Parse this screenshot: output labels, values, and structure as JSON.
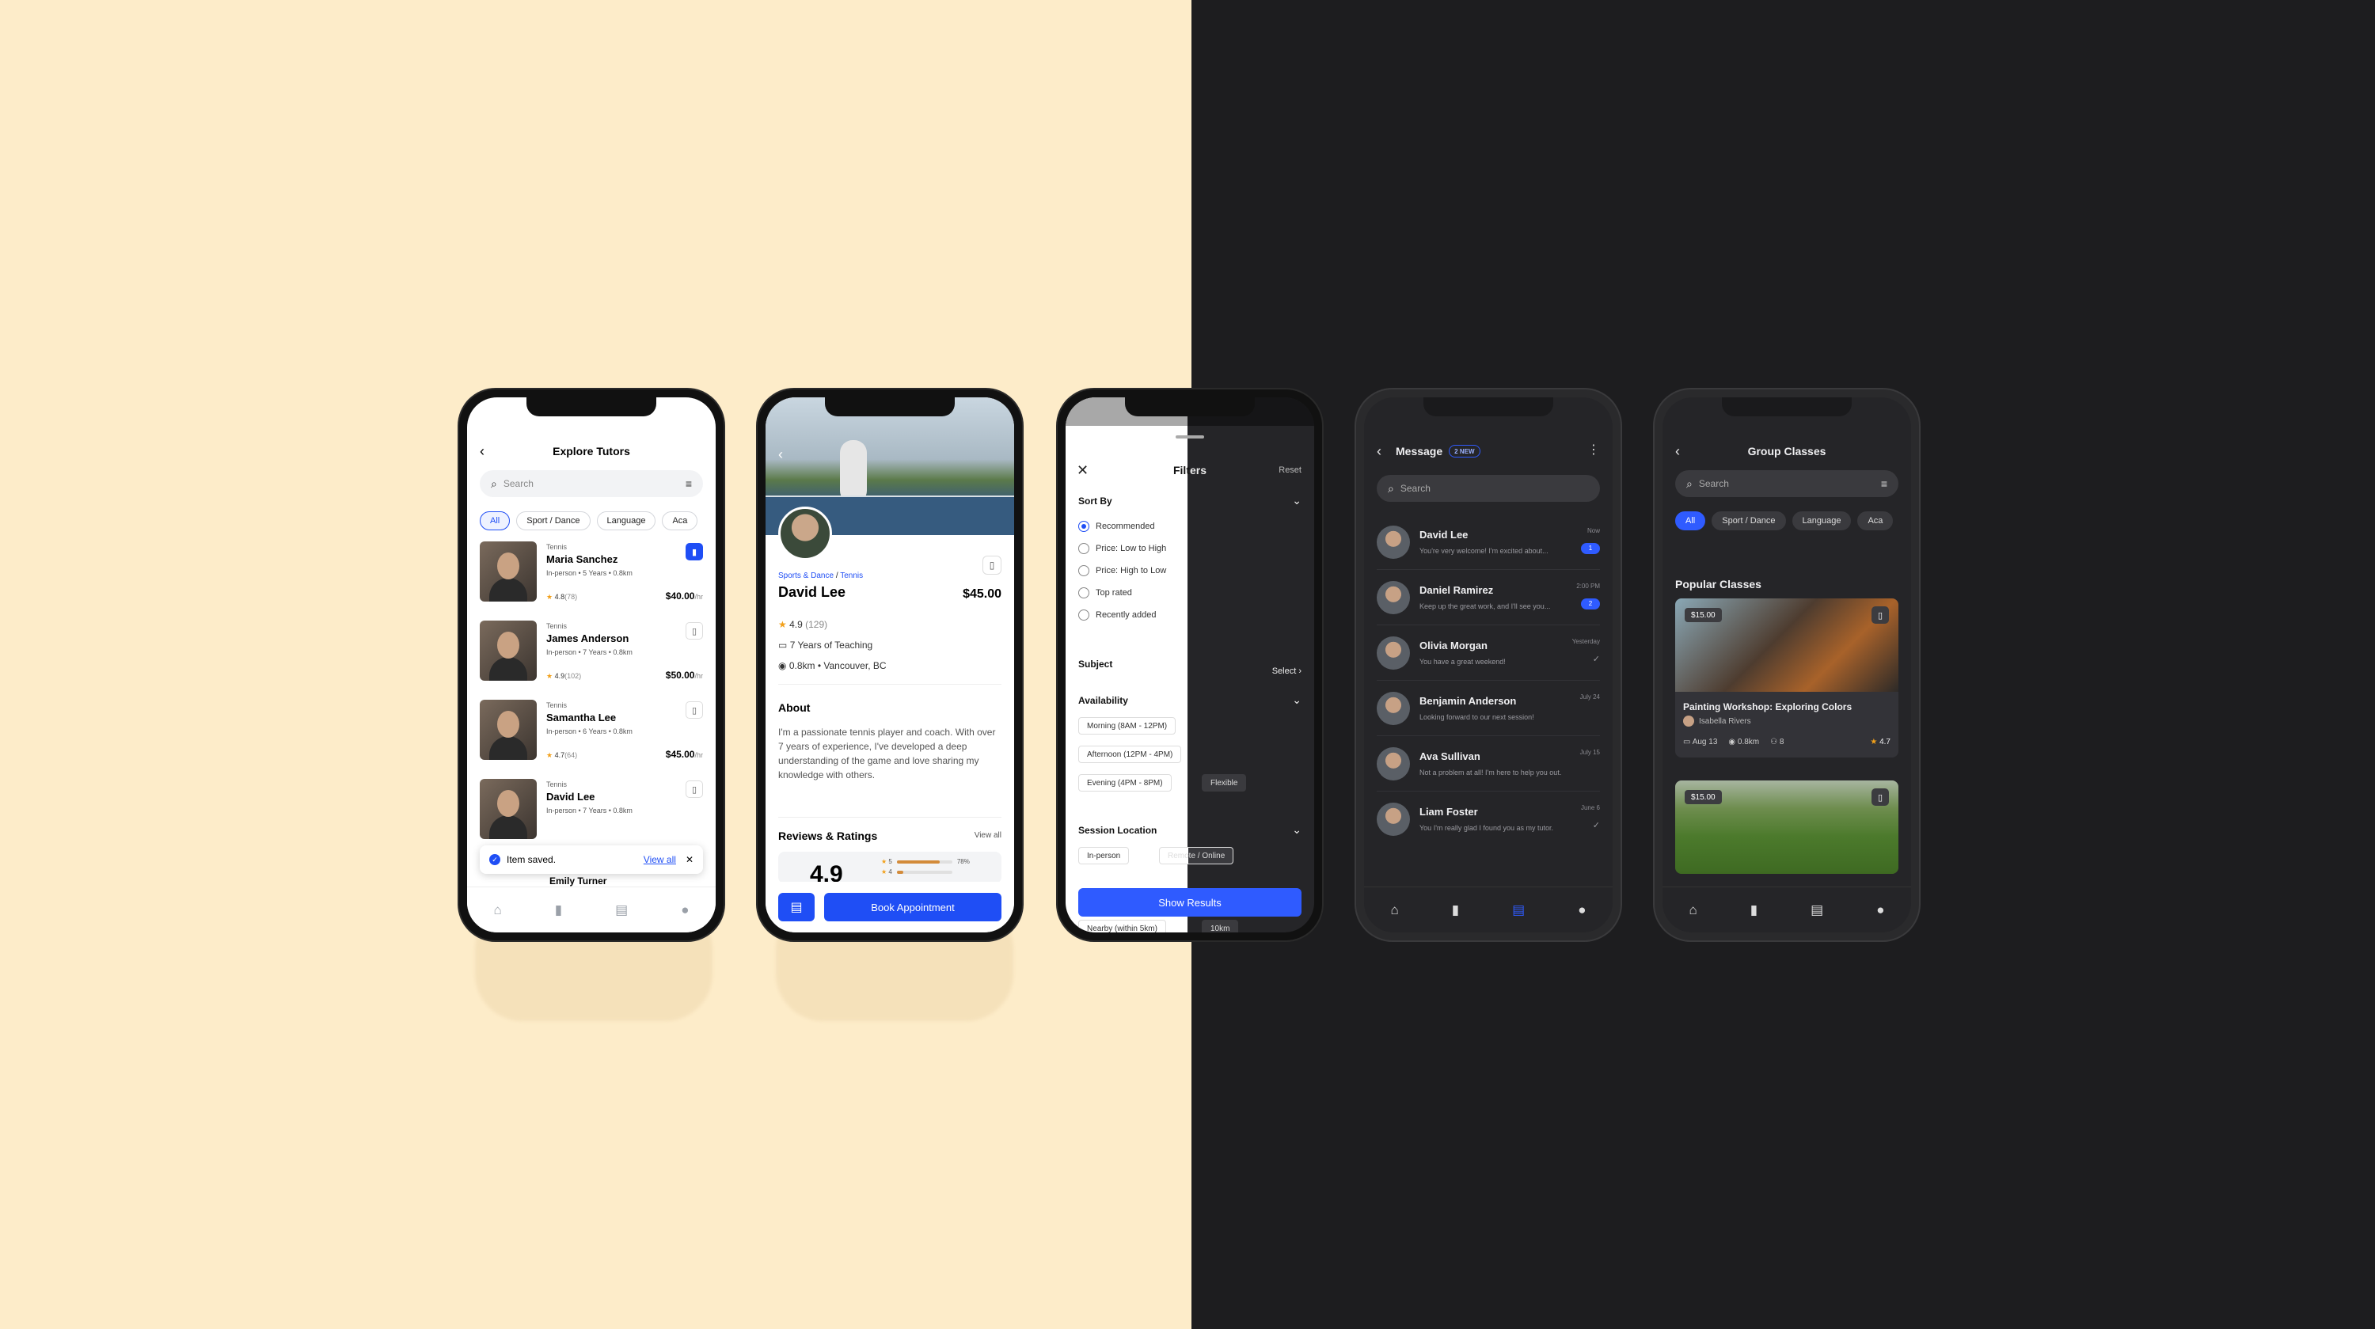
{
  "colors": {
    "accent": "#1f4ef5",
    "accent_dark": "#2f5bff",
    "bg_light": "#fdecc9",
    "bg_dark": "#1d1d1f",
    "star": "#f2a01a"
  },
  "explore": {
    "title": "Explore Tutors",
    "search_placeholder": "Search",
    "chips": [
      "All",
      "Sport / Dance",
      "Language",
      "Aca"
    ],
    "tutors": [
      {
        "tag": "Tennis",
        "name": "Maria Sanchez",
        "meta": "In-person • 5 Years • 0.8km",
        "rating": "4.8",
        "count": "(78)",
        "price": "$40.00",
        "unit": "/hr",
        "saved": true
      },
      {
        "tag": "Tennis",
        "name": "James Anderson",
        "meta": "In-person • 7 Years • 0.8km",
        "rating": "4.9",
        "count": "(102)",
        "price": "$50.00",
        "unit": "/hr",
        "saved": false
      },
      {
        "tag": "Tennis",
        "name": "Samantha Lee",
        "meta": "In-person • 6 Years • 0.8km",
        "rating": "4.7",
        "count": "(64)",
        "price": "$45.00",
        "unit": "/hr",
        "saved": false
      },
      {
        "tag": "Tennis",
        "name": "David Lee",
        "meta": "In-person • 7 Years • 0.8km",
        "rating": "",
        "count": "",
        "price": "",
        "unit": "",
        "saved": false
      }
    ],
    "toast": {
      "text": "Item saved.",
      "action": "View all"
    },
    "peek_name": "Emily Turner"
  },
  "profile": {
    "crumb_a": "Sports & Dance",
    "crumb_sep": " / ",
    "crumb_b": "Tennis",
    "name": "David Lee",
    "price": "$45.00",
    "rating": "4.9",
    "rating_count": "(129)",
    "experience": "7 Years of Teaching",
    "location": "0.8km  •  Vancouver, BC",
    "about_title": "About",
    "about": "I'm a passionate tennis player and coach. With over 7 years of experience, I've developed a deep understanding of the game and love sharing my knowledge with others.",
    "reviews_title": "Reviews & Ratings",
    "view_all": "View all",
    "big_rating": "4.9",
    "bars": [
      {
        "star": "5",
        "pct": "78%",
        "value": 78
      },
      {
        "star": "4",
        "pct": "",
        "value": 12
      }
    ],
    "book": "Book Appointment"
  },
  "filters": {
    "title": "Filters",
    "reset": "Reset",
    "sort_title": "Sort By",
    "sort_options": [
      "Recommended",
      "Price: Low to High",
      "Price: High to Low",
      "Top rated",
      "Recently added"
    ],
    "subject_title": "Subject",
    "subject_action": "Select",
    "availability_title": "Availability",
    "availability": [
      "Morning (8AM - 12PM)",
      "Afternoon (12PM - 4PM)",
      "Evening (4PM - 8PM)",
      "Flexible"
    ],
    "location_title": "Session Location",
    "location": [
      "In-person",
      "Remote / Online"
    ],
    "distance": [
      "Nearby (within 5km)",
      "10km"
    ],
    "show": "Show Results"
  },
  "messages": {
    "title": "Message",
    "badge": "2 NEW",
    "search_placeholder": "Search",
    "items": [
      {
        "name": "David Lee",
        "preview": "You're very welcome! I'm excited about...",
        "time": "Now",
        "badge": "1"
      },
      {
        "name": "Daniel Ramirez",
        "preview": "Keep up the great work, and I'll see you...",
        "time": "2:00 PM",
        "badge": "2"
      },
      {
        "name": "Olivia Morgan",
        "preview": "You have a great weekend!",
        "time": "Yesterday",
        "badge": ""
      },
      {
        "name": "Benjamin Anderson",
        "preview": "Looking forward to our next session!",
        "time": "July 24",
        "badge": ""
      },
      {
        "name": "Ava Sullivan",
        "preview": "Not a problem at all! I'm here to help you out.",
        "time": "July 15",
        "badge": ""
      },
      {
        "name": "Liam Foster",
        "preview": "You I'm really glad I found you as my tutor.",
        "time": "June 6",
        "badge": ""
      }
    ]
  },
  "group": {
    "title": "Group Classes",
    "search_placeholder": "Search",
    "chips": [
      "All",
      "Sport / Dance",
      "Language",
      "Aca"
    ],
    "popular": "Popular Classes",
    "card1": {
      "price": "$15.00",
      "title": "Painting Workshop: Exploring Colors",
      "host": "Isabella Rivers",
      "date": "Aug 13",
      "dist": "0.8km",
      "people": "8",
      "rating": "4.7"
    },
    "card2": {
      "price": "$15.00"
    }
  },
  "icons": {
    "back": "back-arrow-icon",
    "search": "search-icon",
    "filter": "filter-icon",
    "bookmark": "bookmark-icon",
    "home": "home-icon",
    "chat": "chat-icon",
    "profile": "profile-icon",
    "star": "star-icon",
    "close": "close-icon",
    "chevron": "chevron-down-icon",
    "kebab": "more-vertical-icon"
  }
}
